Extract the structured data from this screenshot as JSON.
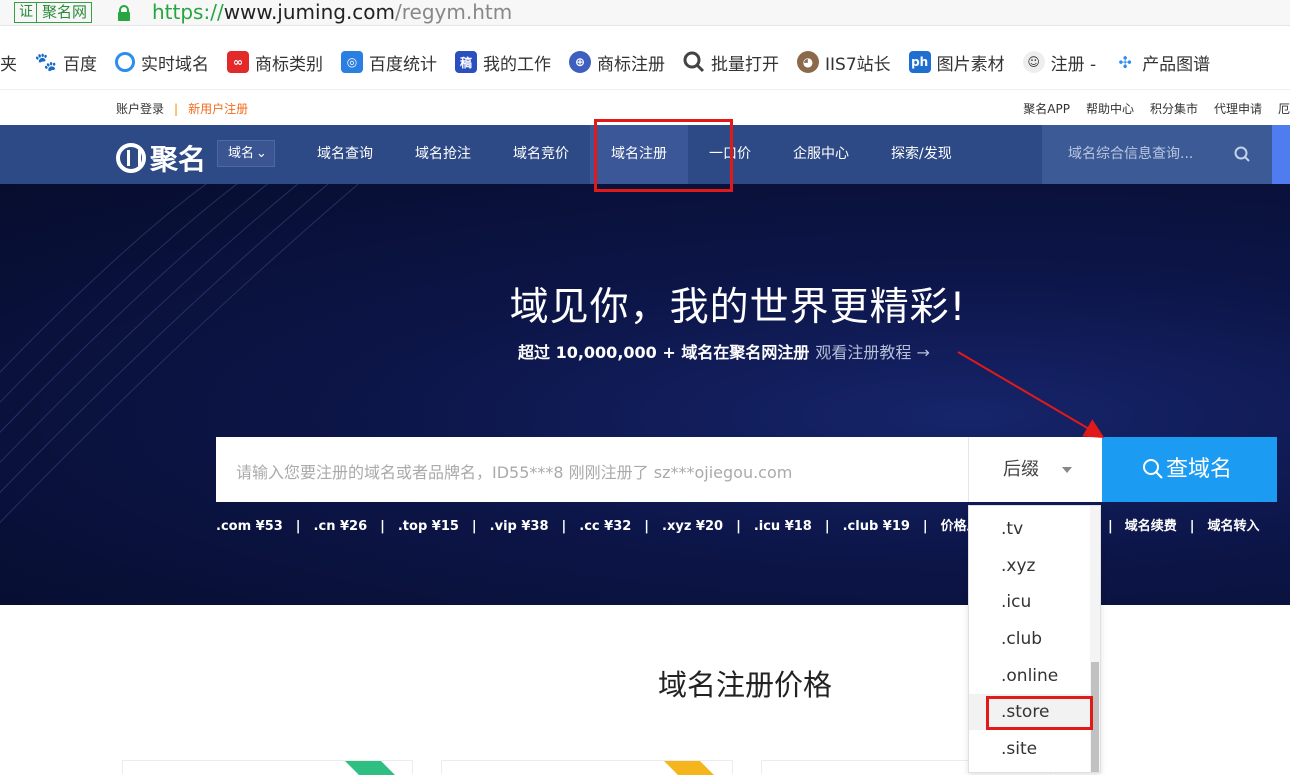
{
  "browser": {
    "cert_label": "证",
    "site_name": "聚名网",
    "url_scheme": "https://",
    "url_host": "www.juming.com",
    "url_path": "/regym.htm"
  },
  "bookmarks": [
    {
      "label": "夹",
      "icon": "folder-icon"
    },
    {
      "label": "百度",
      "icon": "baidu-paw-icon"
    },
    {
      "label": "实时域名",
      "icon": "realtime-icon"
    },
    {
      "label": "商标类别",
      "icon": "trademark-icon"
    },
    {
      "label": "百度统计",
      "icon": "stats-icon"
    },
    {
      "label": "我的工作",
      "icon": "work-icon"
    },
    {
      "label": "商标注册",
      "icon": "shield-icon"
    },
    {
      "label": "批量打开",
      "icon": "magnifier-icon"
    },
    {
      "label": "IIS7站长",
      "icon": "dog-icon"
    },
    {
      "label": "图片素材",
      "icon": "ph-icon"
    },
    {
      "label": "注册 -",
      "icon": "face-icon"
    },
    {
      "label": "产品图谱",
      "icon": "dots-icon"
    }
  ],
  "toplinks": {
    "login": "账户登录",
    "separator": "|",
    "register": "新用户注册",
    "right": [
      "聚名APP",
      "帮助中心",
      "积分集市",
      "代理申请",
      "厄"
    ]
  },
  "nav": {
    "logo": "聚名",
    "select_label": "域名",
    "items": [
      "域名查询",
      "域名抢注",
      "域名竞价",
      "域名注册",
      "一口价",
      "企服中心",
      "探索/发现"
    ],
    "search_placeholder": "域名综合信息查询..."
  },
  "hero": {
    "title": "域见你，我的世界更精彩!",
    "subtitle": "超过 10,000,000 + 域名在聚名网注册",
    "tutorial_link": "观看注册教程",
    "tutorial_arrow": "→",
    "search_placeholder": "请输入您要注册的域名或者品牌名，ID55***8 刚刚注册了 sz***ojiegou.com",
    "suffix_label": "后缀",
    "search_button": "查域名",
    "prices": [
      ".com ¥53",
      ".cn ¥26",
      ".top ¥15",
      ".vip ¥38",
      ".cc ¥32",
      ".xyz ¥20",
      ".icu ¥18",
      ".club ¥19",
      "价格总"
    ],
    "prices_right": [
      "域名续费",
      "域名转入"
    ],
    "price_separator": "|"
  },
  "dropdown": {
    "options": [
      ".tv",
      ".xyz",
      ".icu",
      ".club",
      ".online",
      ".store",
      ".site"
    ],
    "selected": ".store"
  },
  "section": {
    "title": "域名注册价格"
  },
  "colors": {
    "nav_bg": "#2d4a86",
    "hero_bg": "#0c1547",
    "search_button": "#1b9cf2",
    "annotation_red": "#e11919",
    "register_orange": "#f26b1d"
  }
}
